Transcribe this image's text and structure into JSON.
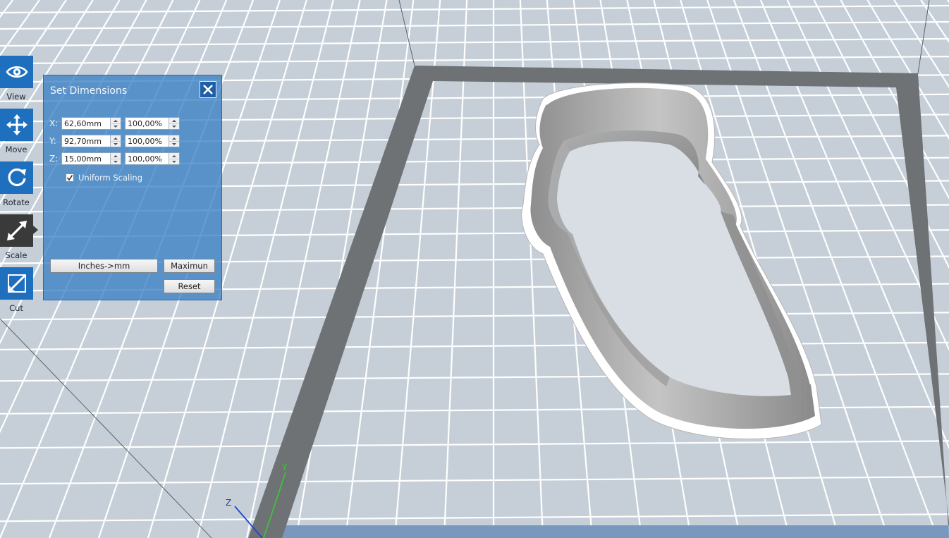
{
  "toolbar": {
    "items": [
      {
        "id": "view",
        "label": "View",
        "icon": "eye-icon"
      },
      {
        "id": "move",
        "label": "Move",
        "icon": "move-arrows-icon"
      },
      {
        "id": "rotate",
        "label": "Rotate",
        "icon": "rotate-icon"
      },
      {
        "id": "scale",
        "label": "Scale",
        "icon": "scale-icon"
      },
      {
        "id": "cut",
        "label": "Cut",
        "icon": "cut-icon"
      }
    ],
    "active": "scale"
  },
  "dialog": {
    "title": "Set Dimensions",
    "rows": [
      {
        "axis": "X:",
        "size": "62,60mm",
        "percent": "100,00%"
      },
      {
        "axis": "Y:",
        "size": "92,70mm",
        "percent": "100,00%"
      },
      {
        "axis": "Z:",
        "size": "15,00mm",
        "percent": "100,00%"
      }
    ],
    "uniform_scaling": {
      "label": "Uniform Scaling",
      "checked": true
    },
    "inches_button": "Inches->mm",
    "max_button": "Maximun",
    "reset_button": "Reset"
  },
  "axes": {
    "y_label": "Y",
    "z_label": "Z"
  },
  "colors": {
    "accent": "#1f6fbf",
    "active_tool": "#3a3a3a",
    "bed": "#c6cfd8",
    "grid": "#ffffff",
    "bed_border": "#6e7275",
    "model": "#9a9a9a"
  }
}
